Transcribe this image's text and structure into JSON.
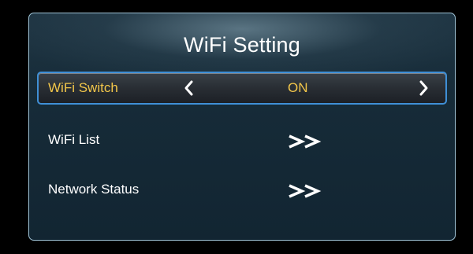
{
  "title": "WiFi Setting",
  "rows": [
    {
      "label": "WiFi Switch",
      "value": "ON",
      "prev_icon": "chevron-left-icon",
      "next_icon": "chevron-right-icon"
    },
    {
      "label": "WiFi List",
      "action_icon": "double-chevron-right-icon"
    },
    {
      "label": "Network Status",
      "action_icon": "double-chevron-right-icon"
    }
  ],
  "colors": {
    "accent_text": "#f2c64a",
    "focus_border": "#3f8fd6",
    "panel_border": "#9fc3d6",
    "panel_bg": "#162b38"
  }
}
